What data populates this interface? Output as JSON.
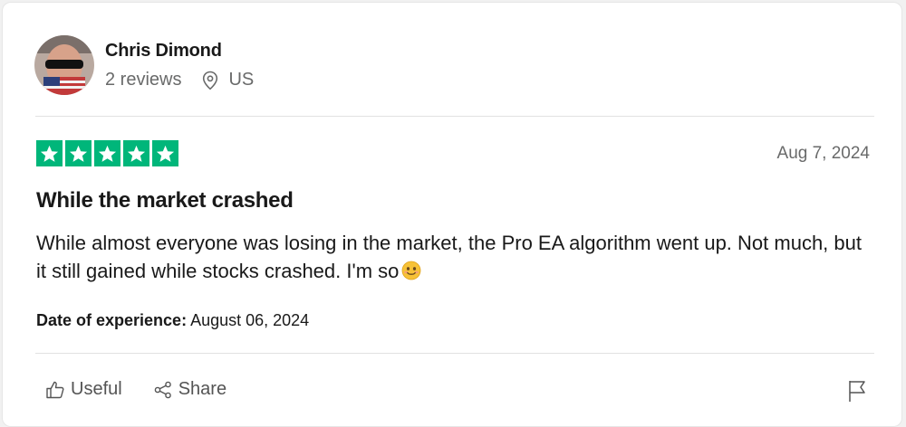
{
  "reviewer": {
    "name": "Chris Dimond",
    "reviews_count": "2 reviews",
    "country": "US"
  },
  "review": {
    "rating": 5,
    "date": "Aug 7, 2024",
    "title": "While the market crashed",
    "body": "While almost everyone was losing in the market, the Pro EA algorithm went up. Not much, but it still gained while stocks crashed. I'm so",
    "date_of_experience_label": "Date of experience:",
    "date_of_experience": "August 06, 2024"
  },
  "actions": {
    "useful_label": "Useful",
    "share_label": "Share"
  },
  "colors": {
    "star_green": "#00b67a",
    "muted_text": "#696a6a"
  },
  "icons": [
    "location-pin-icon",
    "star-icon",
    "smiley-emoji-icon",
    "thumbs-up-icon",
    "share-icon",
    "flag-icon"
  ]
}
